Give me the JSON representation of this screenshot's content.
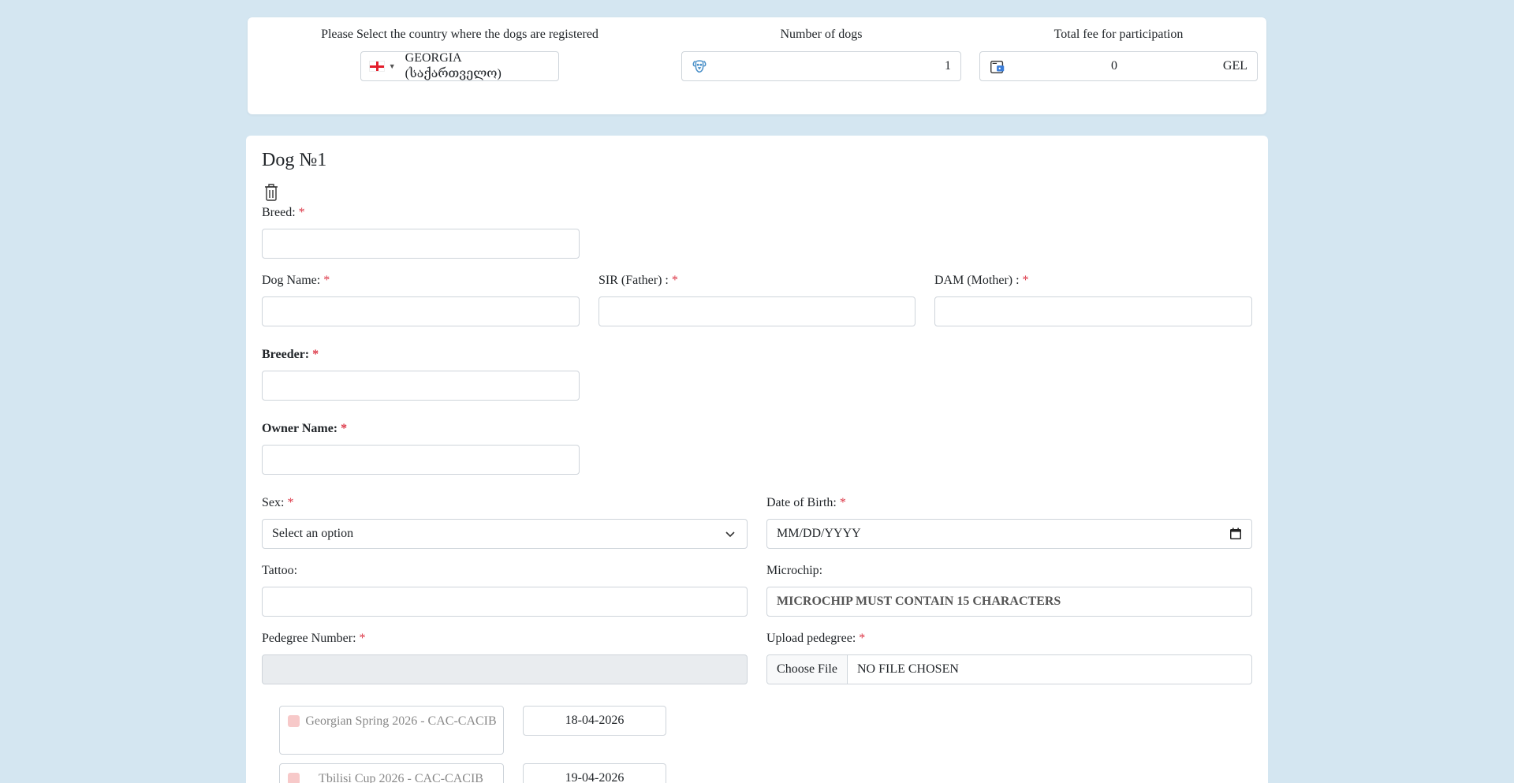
{
  "header": {
    "country_label": "Please Select the country where the dogs are registered",
    "country_value": "GEORGIA (საქართველო)",
    "dogs_label": "Number of dogs",
    "dogs_value": "1",
    "fee_label": "Total fee for participation",
    "fee_value": "0",
    "fee_currency": "GEL"
  },
  "dog": {
    "title": "Dog №1",
    "breed_label": "Breed:",
    "name_label": "Dog Name:",
    "sir_label": "SIR (Father) :",
    "dam_label": "DAM (Mother) :",
    "breeder_label": "Breeder:",
    "owner_label": "Owner Name:",
    "sex_label": "Sex:",
    "sex_value": "Select an option",
    "dob_label": "Date of Birth:",
    "dob_placeholder": "MM/DD/YYYY",
    "tattoo_label": "Tattoo:",
    "microchip_label": "Microchip:",
    "microchip_placeholder": "MICROCHIP MUST CONTAIN 15 CHARACTERS",
    "pedigree_label": "Pedegree Number:",
    "upload_label": "Upload pedegree:",
    "file_button": "Choose File",
    "file_status": "NO FILE CHOSEN",
    "required_mark": "*"
  },
  "shows": [
    {
      "name": "Georgian Spring 2026 - CAC-CACIB",
      "date": "18-04-2026"
    },
    {
      "name": "Tbilisi Cup 2026 - CAC-CACIB",
      "date": "19-04-2026"
    }
  ],
  "icons": {
    "flag": "georgia-flag-icon",
    "dogs": "dog-icon",
    "fee": "wallet-icon",
    "delete": "trash-icon",
    "sex_dropdown": "chevron-down-icon",
    "dob_picker": "calendar-icon"
  },
  "colors": {
    "background": "#d4e6f1",
    "required": "#dc3545",
    "checkbox": "#f7c9c9"
  }
}
